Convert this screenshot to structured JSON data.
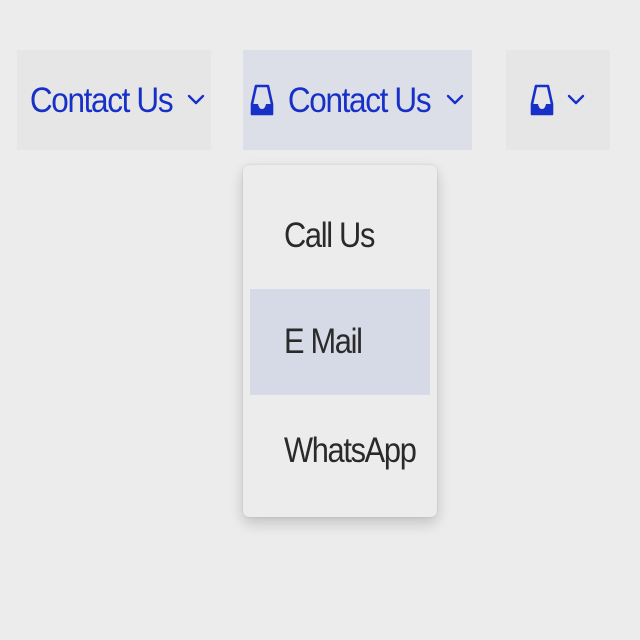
{
  "buttons": [
    {
      "label": "Contact Us",
      "icon": "chevron-down-icon",
      "state": "default"
    },
    {
      "label": "Contact Us",
      "icon": "inbox-icon",
      "state": "open"
    },
    {
      "label": "",
      "icon": "inbox-icon",
      "state": "default"
    }
  ],
  "dropdown": {
    "items": [
      {
        "label": "Call Us"
      },
      {
        "label": "E Mail",
        "highlighted": true
      },
      {
        "label": "WhatsApp"
      }
    ]
  },
  "colors": {
    "accent": "#1730c8",
    "background": "#ececec",
    "button_bg": "#e6e6e6",
    "active_bg": "#dcdee8",
    "highlight_bg": "#d6d9e6",
    "menu_text": "#2a2a2a"
  }
}
